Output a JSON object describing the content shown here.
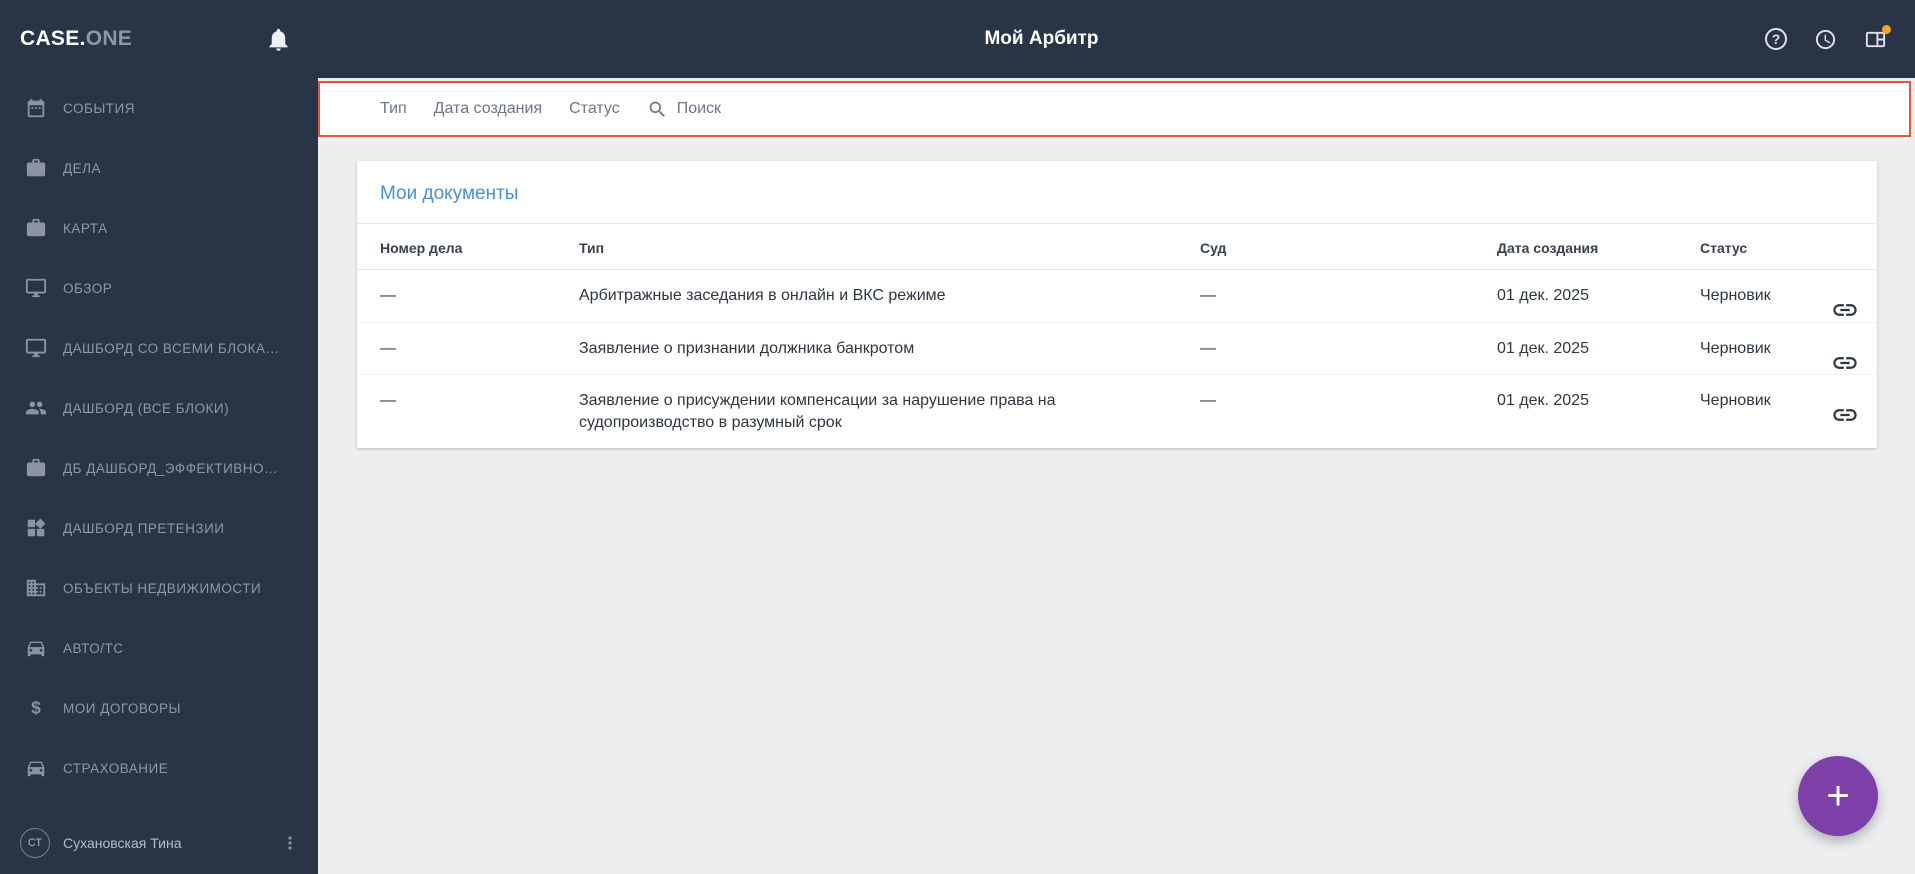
{
  "topbar": {
    "logo_primary": "CASE.",
    "logo_secondary": "ONE",
    "title": "Мой Арбитр",
    "help_glyph": "?"
  },
  "sidebar": {
    "items": [
      {
        "id": "events",
        "icon": "calendar",
        "label": "СОБЫТИЯ"
      },
      {
        "id": "cases",
        "icon": "briefcase",
        "label": "ДЕЛА"
      },
      {
        "id": "map",
        "icon": "briefcase",
        "label": "КАРТА"
      },
      {
        "id": "overview",
        "icon": "monitor",
        "label": "ОБЗОР"
      },
      {
        "id": "dashboard-all-blocks",
        "icon": "monitor",
        "label": "ДАШБОРД СО ВСЕМИ БЛОКА…"
      },
      {
        "id": "dashboard-vse-bloki",
        "icon": "users",
        "label": "ДАШБОРД (ВСЕ БЛОКИ)"
      },
      {
        "id": "db-dashboard-effective",
        "icon": "briefcase",
        "label": "ДБ ДАШБОРД_ЭФФЕКТИВНО…"
      },
      {
        "id": "dashboard-pretenzii",
        "icon": "widgets",
        "label": "ДАШБОРД ПРЕТЕНЗИИ"
      },
      {
        "id": "real-estate",
        "icon": "building",
        "label": "ОБЪЕКТЫ НЕДВИЖИМОСТИ"
      },
      {
        "id": "auto-ts",
        "icon": "car",
        "label": "АВТО/ТС"
      },
      {
        "id": "my-contracts",
        "icon": "dollar",
        "label": "МОИ ДОГОВОРЫ"
      },
      {
        "id": "insurance",
        "icon": "car",
        "label": "СТРАХОВАНИЕ"
      }
    ],
    "user": {
      "initials": "СТ",
      "name": "Сухановская Тина"
    }
  },
  "filters": {
    "type_label": "Тип",
    "date_label": "Дата создания",
    "status_label": "Статус",
    "search_placeholder": "Поиск"
  },
  "documents": {
    "title": "Мои документы",
    "columns": [
      "Номер дела",
      "Тип",
      "Суд",
      "Дата создания",
      "Статус"
    ],
    "rows": [
      {
        "case_number": "—",
        "type": "Арбитражные заседания в онлайн и ВКС режиме",
        "court": "—",
        "created": "01 дек. 2025",
        "status": "Черновик",
        "link_active": true
      },
      {
        "case_number": "—",
        "type": "Заявление о признании должника банкротом",
        "court": "—",
        "created": "01 дек. 2025",
        "status": "Черновик",
        "link_active": false
      },
      {
        "case_number": "—",
        "type": "Заявление о присуждении компенсации за нарушение права на судопроизводство в разумный срок",
        "court": "—",
        "created": "01 дек. 2025",
        "status": "Черновик",
        "link_active": false
      }
    ]
  },
  "fab": {
    "label": "+"
  },
  "colors": {
    "accent_blue": "#4a90d5",
    "fab_purple": "#7d3fa8",
    "highlight_red": "#e2573b",
    "link_active": "#4a7fd0",
    "link_inactive": "#c3c8d0",
    "badge_orange": "#f5a623",
    "topbar_bg": "#2a3447"
  }
}
